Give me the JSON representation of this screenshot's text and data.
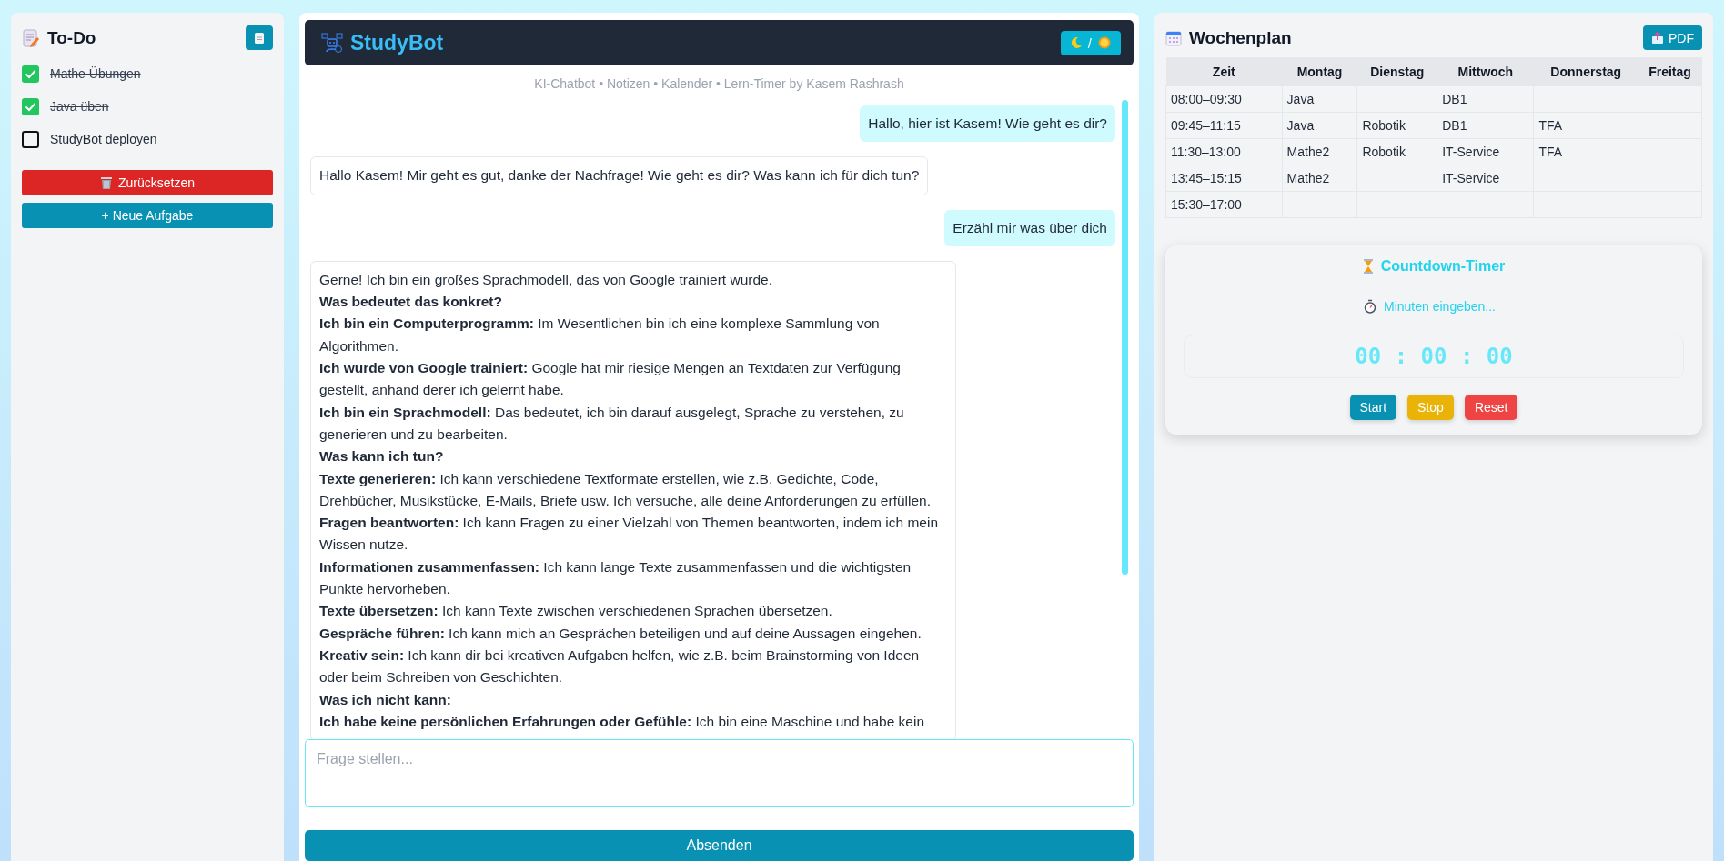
{
  "todo": {
    "title": "To-Do",
    "items": [
      {
        "text": "Mathe Übungen",
        "checked": true
      },
      {
        "text": "Java üben",
        "checked": true
      },
      {
        "text": "StudyBot deployen",
        "checked": false
      }
    ],
    "buttons": [
      {
        "label": "Zurücksetzen",
        "kind": "reset"
      },
      {
        "label": "+ Neue Aufgabe",
        "kind": "add"
      }
    ]
  },
  "chat": {
    "title": "StudyBot",
    "theme_toggle": "/",
    "subtitle": "KI-Chatbot • Notizen • Kalender • Lern-Timer by Kasem Rashrash",
    "messages": [
      {
        "kind": "user",
        "lines": [
          {
            "kind": "text",
            "text": "Hallo, hier ist Kasem! Wie geht es dir?"
          }
        ]
      },
      {
        "kind": "bot",
        "lines": [
          {
            "kind": "text",
            "text": "Hallo Kasem! Mir geht es gut, danke der Nachfrage! Wie geht es dir? Was kann ich für dich tun?"
          }
        ]
      },
      {
        "kind": "user",
        "lines": [
          {
            "kind": "text",
            "text": "Erzähl mir was über dich"
          }
        ]
      },
      {
        "kind": "bot",
        "lines": [
          {
            "kind": "text",
            "text": "Gerne! Ich bin ein großes Sprachmodell, das von Google trainiert wurde."
          },
          {
            "kind": "heading",
            "text": "Was bedeutet das konkret?"
          },
          {
            "kind": "text",
            "text": "**Ich bin ein Computerprogramm:** Im Wesentlichen bin ich eine komplexe Sammlung von Algorithmen."
          },
          {
            "kind": "text",
            "text": "**Ich wurde von Google trainiert:** Google hat mir riesige Mengen an Textdaten zur Verfügung gestellt, anhand derer ich gelernt habe."
          },
          {
            "kind": "text",
            "text": "**Ich bin ein Sprachmodell:** Das bedeutet, ich bin darauf ausgelegt, Sprache zu verstehen, zu generieren und zu bearbeiten."
          },
          {
            "kind": "heading",
            "text": "Was kann ich tun?"
          },
          {
            "kind": "text",
            "text": "**Texte generieren:** Ich kann verschiedene Textformate erstellen, wie z.B. Gedichte, Code, Drehbücher, Musikstücke, E-Mails, Briefe usw. Ich versuche, alle deine Anforderungen zu erfüllen."
          },
          {
            "kind": "text",
            "text": "**Fragen beantworten:** Ich kann Fragen zu einer Vielzahl von Themen beantworten, indem ich mein Wissen nutze."
          },
          {
            "kind": "text",
            "text": "**Informationen zusammenfassen:** Ich kann lange Texte zusammenfassen und die wichtigsten Punkte hervorheben."
          },
          {
            "kind": "text",
            "text": "**Texte übersetzen:** Ich kann Texte zwischen verschiedenen Sprachen übersetzen."
          },
          {
            "kind": "text",
            "text": "**Gespräche führen:** Ich kann mich an Gesprächen beteiligen und auf deine Aussagen eingehen."
          },
          {
            "kind": "text",
            "text": "**Kreativ sein:** Ich kann dir bei kreativen Aufgaben helfen, wie z.B. beim Brainstorming von Ideen oder beim Schreiben von Geschichten."
          },
          {
            "kind": "heading",
            "text": "Was ich nicht kann:"
          },
          {
            "kind": "text",
            "text": "**Ich habe keine persönlichen Erfahrungen oder Gefühle:** Ich bin eine Maschine und habe kein"
          }
        ]
      }
    ],
    "input": {
      "placeholder": "Frage stellen..."
    },
    "send_button": "Absenden"
  },
  "schedule": {
    "title": "Wochenplan",
    "pdf_button": "PDF",
    "columns": [
      "Zeit",
      "Montag",
      "Dienstag",
      "Mittwoch",
      "Donnerstag",
      "Freitag"
    ],
    "rows": [
      [
        "08:00–09:30",
        "Java",
        "",
        "DB1",
        "",
        ""
      ],
      [
        "09:45–11:15",
        "Java",
        "Robotik",
        "DB1",
        "TFA",
        ""
      ],
      [
        "11:30–13:00",
        "Mathe2",
        "Robotik",
        "IT-Service",
        "TFA",
        ""
      ],
      [
        "13:45–15:15",
        "Mathe2",
        "",
        "IT-Service",
        "",
        ""
      ],
      [
        "15:30–17:00",
        "",
        "",
        "",
        "",
        ""
      ]
    ]
  },
  "timer": {
    "title": "Countdown-Timer",
    "placeholder": "Minuten eingeben...",
    "display": "00 : 00 : 00",
    "buttons": [
      {
        "label": "Start",
        "kind": "start"
      },
      {
        "label": "Stop",
        "kind": "stop"
      },
      {
        "label": "Reset",
        "kind": "reset"
      }
    ]
  }
}
